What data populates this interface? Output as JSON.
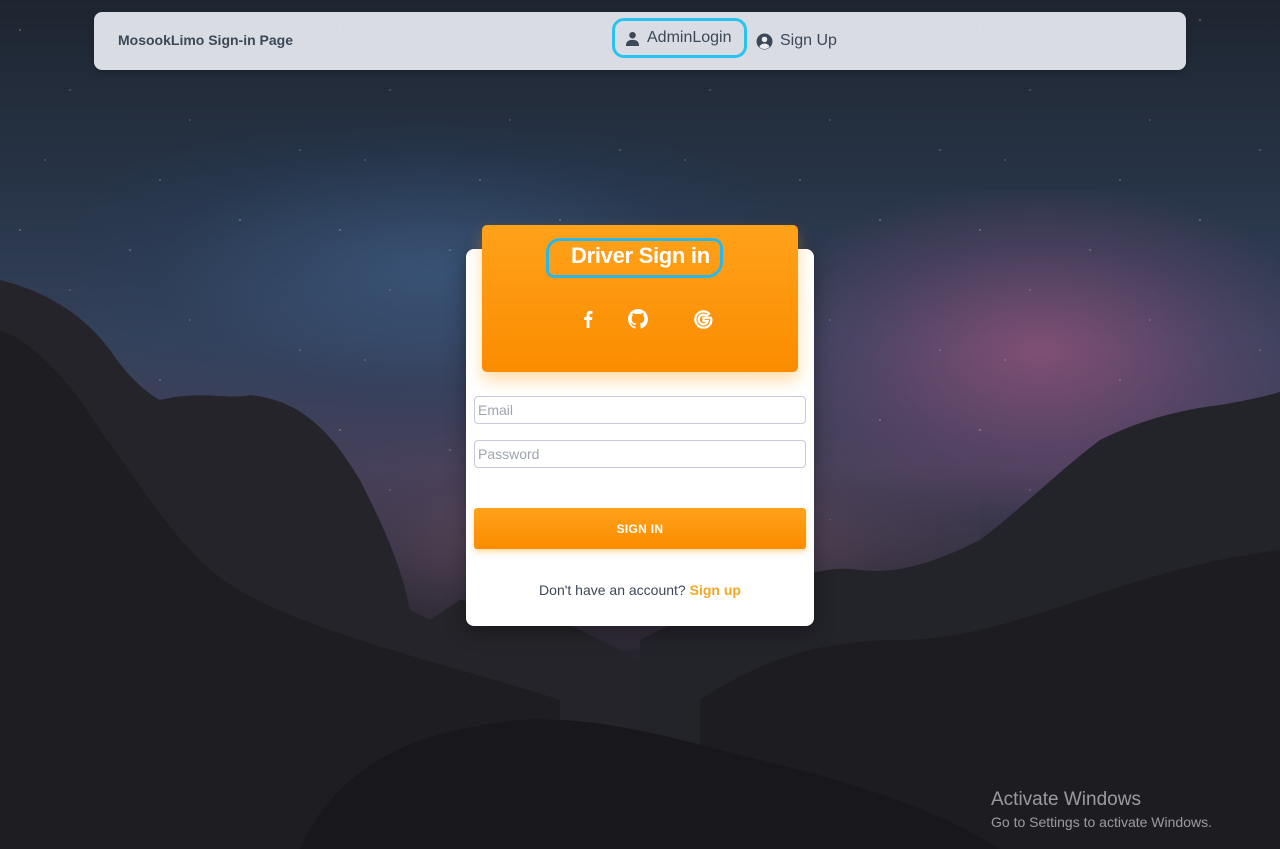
{
  "navbar": {
    "brand": "MosookLimo Sign-in Page",
    "admin_login": "AdminLogin",
    "sign_up": "Sign Up"
  },
  "card": {
    "title": "Driver Sign in",
    "social_icons": [
      "facebook-icon",
      "github-icon",
      "google-icon"
    ],
    "email_placeholder": "Email",
    "password_placeholder": "Password",
    "signin_label": "SIGN IN",
    "footer_prompt": "Don't have an account?",
    "footer_link": "Sign up"
  },
  "watermark": {
    "title": "Activate Windows",
    "subtitle": "Go to Settings to activate Windows."
  },
  "colors": {
    "accent": "#fb8c00",
    "highlight": "#29c3f2",
    "link": "#f5a623"
  }
}
